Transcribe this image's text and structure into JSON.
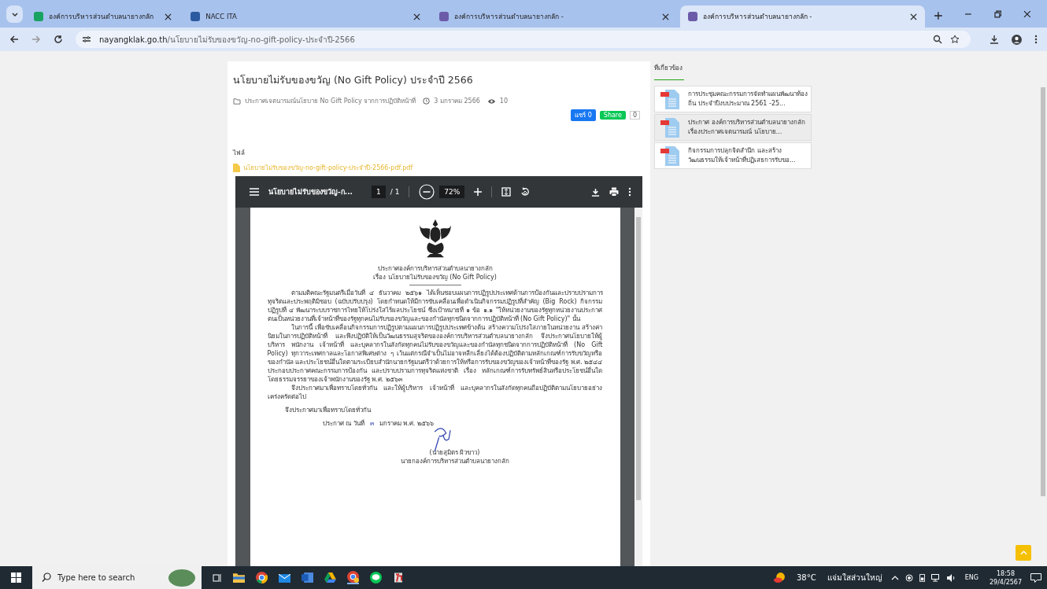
{
  "browser": {
    "tabs": [
      {
        "title": "องค์การบริหารส่วนตำบลนายางกลัก",
        "selected": false
      },
      {
        "title": "NACC ITA",
        "selected": false
      },
      {
        "title": "องค์การบริหารส่วนตำบลนายางกลัก -",
        "selected": false
      },
      {
        "title": "องค์การบริหารส่วนตำบลนายางกลัก -",
        "selected": true
      }
    ],
    "url_host": "nayangklak.go.th",
    "url_path": "/นโยบายไม่รับของขวัญ-no-gift-policy-ประจำปี-2566"
  },
  "article": {
    "title": "นโยบายไม่รับของขวัญ (No Gift Policy) ประจำปี 2566",
    "category": "ประกาศเจตนารมณ์นโยบาย No Gift Policy จากการปฏิบัติหน้าที่",
    "date": "3 มกราคม 2566",
    "views": "10",
    "share": {
      "facebook": "แชร์ 0",
      "line": "Share",
      "count": "0"
    },
    "files_label": "ไฟล์",
    "file_link": "นโยบายไม่รับของขวัญ-no-gift-policy-ประจำปี-2566-pdf.pdf"
  },
  "pdf_viewer": {
    "title": "นโยบายไม่รับของขวัญ-ก...",
    "page_current": "1",
    "page_total": "/ 1",
    "zoom": "72%",
    "document": {
      "heading": [
        "ประกาศองค์การบริหารส่วนตำบลนายางกลัก",
        "เรื่อง  นโยบายไม่รับของขวัญ (No Gift Policy)"
      ],
      "paragraphs": [
        {
          "kind": "indent",
          "text": "ตามมติคณะรัฐมนตรีเมื่อวันที่ ๔ ธันวาคม ๒๕๖๑ ได้เห็นชอบแผนการปฏิรูปประเทศด้านการป้องกันและปราบปรามการทุจริตและประพฤติมิชอบ (ฉบับปรับปรุง) โดยกำหนดให้มีการขับเคลื่อนเพื่อดำเนินกิจกรรมปฏิรูปที่สำคัญ (Big Rock) กิจกรรมปฏิรูปที่ ๔ พัฒนาระบบราชการไทยให้โปร่งใสไร้ผลประโยชน์ ซึ่งเป้าหมายที่ ๑ ข้อ ๑.๑ \"ให้หน่วยงานของรัฐทุกหน่วยงานประกาศตนเป็นหน่วยงานที่เจ้าหน้าที่ของรัฐทุกคนไม่รับของขวัญและของกำนัลทุกชนิดจากการปฏิบัติหน้าที่ (No Gift Policy)\" นั้น"
        },
        {
          "kind": "indent",
          "text": "ในการนี้ เพื่อขับเคลื่อนกิจกรรมการปฏิรูปตามแผนการปฏิรูปประเทศข้างต้น สร้างความโปร่งใสภายในหน่วยงาน สร้างค่านิยมในการปฏิบัติหน้าที่ และพึงปฏิบัติให้เป็นวัฒนธรรมสุจริตขององค์การบริหารส่วนตำบลนายางกลัก จึงประกาศนโยบายให้ผู้บริหาร พนักงาน เจ้าหน้าที่ และบุคลากรในสังกัดทุกคนไม่รับของขวัญและของกำนัลทุกชนิดจากการปฏิบัติหน้าที่ (No Gift Policy) ทุกวาระเทศกาลและโอกาสพิเศษต่าง ๆ เว้นแต่กรณีจำเป็นไม่อาจหลีกเลี่ยงได้ต้องปฏิบัติตามหลักเกณฑ์การรับขวัญหรือของกำนัล และประโยชน์อื่นใดตามระเบียบสำนักนายกรัฐมนตรีว่าด้วยการให้หรือการรับของขวัญของเจ้าหน้าที่ของรัฐ พ.ศ. ๒๕๔๔ ประกอบประกาศคณะกรรมการป้องกัน และปราบปรามการทุจริตแห่งชาติ เรื่อง หลักเกณฑ์การรับทรัพย์สินหรือประโยชน์อื่นใดโดยธรรมจรรยาของเจ้าพนักงานของรัฐ พ.ศ. ๒๕๖๓"
        },
        {
          "kind": "indent",
          "text": "จึงประกาศมาเพื่อทราบโดยทั่วกัน และให้ผู้บริหาร เจ้าหน้าที่ และบุคลากรในสังกัดทุกคนถือปฏิบัติตามนโยบายอย่างเคร่งครัดต่อไป"
        },
        {
          "kind": "closing",
          "text": "จึงประกาศมาเพื่อทราบโดยทั่วกัน"
        }
      ],
      "date_line": "ประกาศ ณ วันที่",
      "date_day": "๓",
      "date_rest": "มกราคม พ.ศ. ๒๕๖๖",
      "signer_name": "(นายสุมิตร ผิวขาว)",
      "signer_title": "นายกองค์การบริหารส่วนตำบลนายางกลัก"
    }
  },
  "sidebar": {
    "heading": "ที่เกี่ยวข้อง",
    "items": [
      {
        "text": "การประชุมคณะกรรมการจัดทำแผนพัฒนาท้องถิ่น ประจำปีงบประมาณ 2561 -25...",
        "selected": false
      },
      {
        "text": "ประกาศ องค์การบริหารส่วนตำบลนายางกลัก เรื่องประกาศเจตนารมณ์ นโยบาย...",
        "selected": true
      },
      {
        "text": "กิจกรรมการปลุกจิตสำนึก และสร้างวัฒนธรรมให้เจ้าหน้าที่ปฏิเสธการรับขอ...",
        "selected": false
      }
    ]
  },
  "taskbar": {
    "search_placeholder": "Type here to search",
    "temperature": "38°C",
    "weather": "แจ่มใสส่วนใหญ่",
    "language": "ENG",
    "time": "18:58",
    "date": "29/4/2567"
  }
}
